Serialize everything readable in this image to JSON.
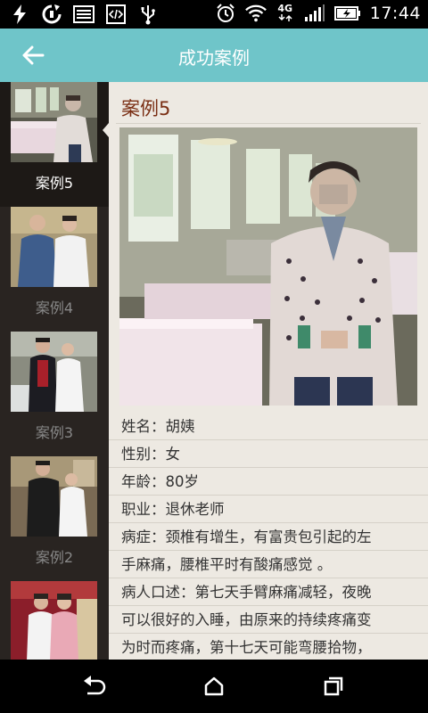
{
  "status_bar": {
    "time": "17:44",
    "network_type": "4G",
    "icons": [
      "flash-icon",
      "sync-icon",
      "image-icon",
      "code-icon",
      "usb-icon",
      "alarm-icon",
      "wifi-icon",
      "signal-icon",
      "battery-charging-icon"
    ]
  },
  "app_bar": {
    "title": "成功案例",
    "back_icon": "arrow-left-icon",
    "color": "#6fc5c9"
  },
  "sidebar": {
    "items": [
      {
        "label": "案例5",
        "active": true
      },
      {
        "label": "案例4",
        "active": false
      },
      {
        "label": "案例3",
        "active": false
      },
      {
        "label": "案例2",
        "active": false
      },
      {
        "label": "",
        "active": false
      }
    ]
  },
  "detail": {
    "case_title": "案例5",
    "info_lines": [
      "姓名：胡姨",
      "性别：女",
      "年龄：80岁",
      "职业：退休老师",
      "病症：颈椎有增生，有富贵包引起的左",
      "手麻痛，腰椎平时有酸痛感觉 。",
      "病人口述：第七天手臂麻痛减轻，夜晚",
      "可以很好的入睡，由原来的持续疼痛变",
      "为时而疼痛，第十七天可能弯腰拾物，"
    ]
  },
  "nav_bar": {
    "icons": [
      "back-nav-icon",
      "home-icon",
      "recents-icon"
    ]
  }
}
